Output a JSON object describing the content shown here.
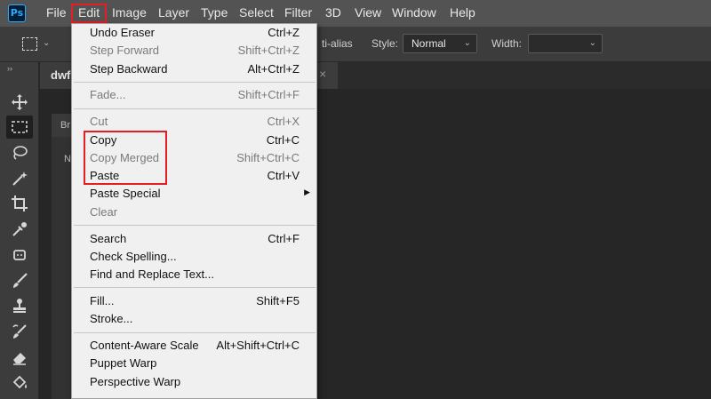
{
  "app": {
    "logo": "Ps"
  },
  "menubar": {
    "items": [
      "File",
      "Edit",
      "Image",
      "Layer",
      "Type",
      "Select",
      "Filter",
      "3D",
      "View",
      "Window",
      "Help"
    ],
    "active": "Edit"
  },
  "options": {
    "antialias_fragment": "ti-alias",
    "style_label": "Style:",
    "style_value": "Normal",
    "width_label": "Width:",
    "width_value": ""
  },
  "document": {
    "tab_label": "dwf",
    "close_symbol": "×",
    "panel_fragment_1": "Br",
    "panel_fragment_2": "N"
  },
  "edit_menu": {
    "groups": [
      [
        {
          "label": "Undo Eraser",
          "shortcut": "Ctrl+Z",
          "enabled": true
        },
        {
          "label": "Step Forward",
          "shortcut": "Shift+Ctrl+Z",
          "enabled": false
        },
        {
          "label": "Step Backward",
          "shortcut": "Alt+Ctrl+Z",
          "enabled": true
        }
      ],
      [
        {
          "label": "Fade...",
          "shortcut": "Shift+Ctrl+F",
          "enabled": false
        }
      ],
      [
        {
          "label": "Cut",
          "shortcut": "Ctrl+X",
          "enabled": false
        },
        {
          "label": "Copy",
          "shortcut": "Ctrl+C",
          "enabled": true
        },
        {
          "label": "Copy Merged",
          "shortcut": "Shift+Ctrl+C",
          "enabled": false
        },
        {
          "label": "Paste",
          "shortcut": "Ctrl+V",
          "enabled": true
        },
        {
          "label": "Paste Special",
          "shortcut": "",
          "enabled": true,
          "submenu": true
        },
        {
          "label": "Clear",
          "shortcut": "",
          "enabled": false
        }
      ],
      [
        {
          "label": "Search",
          "shortcut": "Ctrl+F",
          "enabled": true
        },
        {
          "label": "Check Spelling...",
          "shortcut": "",
          "enabled": true
        },
        {
          "label": "Find and Replace Text...",
          "shortcut": "",
          "enabled": true
        }
      ],
      [
        {
          "label": "Fill...",
          "shortcut": "Shift+F5",
          "enabled": true
        },
        {
          "label": "Stroke...",
          "shortcut": "",
          "enabled": true
        }
      ],
      [
        {
          "label": "Content-Aware Scale",
          "shortcut": "Alt+Shift+Ctrl+C",
          "enabled": true
        },
        {
          "label": "Puppet Warp",
          "shortcut": "",
          "enabled": true
        },
        {
          "label": "Perspective Warp",
          "shortcut": "",
          "enabled": true
        }
      ]
    ]
  },
  "tools": [
    {
      "name": "move-tool-icon"
    },
    {
      "name": "rectangular-marquee-tool-icon",
      "selected": true
    },
    {
      "name": "lasso-tool-icon"
    },
    {
      "name": "magic-wand-tool-icon"
    },
    {
      "name": "crop-tool-icon"
    },
    {
      "name": "eyedropper-tool-icon"
    },
    {
      "name": "spot-healing-tool-icon"
    },
    {
      "name": "brush-tool-icon"
    },
    {
      "name": "clone-stamp-tool-icon"
    },
    {
      "name": "history-brush-tool-icon"
    },
    {
      "name": "eraser-tool-icon"
    },
    {
      "name": "paint-bucket-tool-icon"
    }
  ],
  "colors": {
    "highlight": "#e31e24",
    "menubar": "#535353",
    "menu_bg": "#f0f0f0",
    "ps_blue": "#31a8ff"
  }
}
